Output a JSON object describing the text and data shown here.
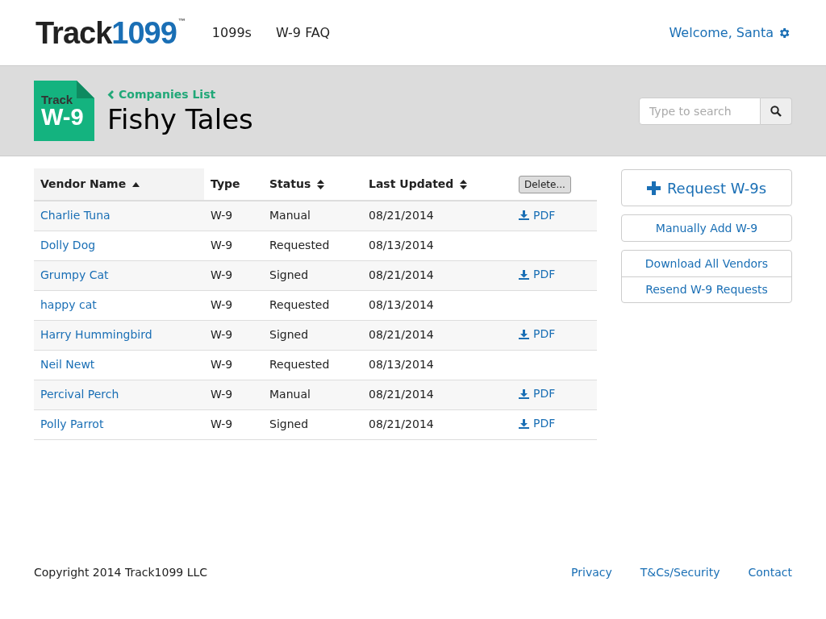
{
  "logo": {
    "word": "Track",
    "number": "1099",
    "mark": "™"
  },
  "nav": [
    {
      "label": "1099s"
    },
    {
      "label": "W-9 FAQ"
    }
  ],
  "user": {
    "welcome": "Welcome, Santa"
  },
  "badge": {
    "top": "Track",
    "main": "W-9"
  },
  "breadcrumb": {
    "label": "Companies List"
  },
  "page_title": "Fishy Tales",
  "search": {
    "placeholder": "Type to search"
  },
  "table": {
    "columns": [
      {
        "label": "Vendor Name",
        "sortable": true,
        "sorted": true
      },
      {
        "label": "Type",
        "sortable": false,
        "sorted": false
      },
      {
        "label": "Status",
        "sortable": true,
        "sorted": false
      },
      {
        "label": "Last Updated",
        "sortable": true,
        "sorted": false
      }
    ],
    "delete_button": "Delete...",
    "rows": [
      {
        "name": "Charlie Tuna",
        "type": "W-9",
        "status": "Manual",
        "updated": "08/21/2014",
        "pdf": "PDF"
      },
      {
        "name": "Dolly Dog",
        "type": "W-9",
        "status": "Requested",
        "updated": "08/13/2014"
      },
      {
        "name": "Grumpy Cat",
        "type": "W-9",
        "status": "Signed",
        "updated": "08/21/2014",
        "pdf": "PDF"
      },
      {
        "name": "happy cat",
        "type": "W-9",
        "status": "Requested",
        "updated": "08/13/2014"
      },
      {
        "name": "Harry Hummingbird",
        "type": "W-9",
        "status": "Signed",
        "updated": "08/21/2014",
        "pdf": "PDF"
      },
      {
        "name": "Neil Newt",
        "type": "W-9",
        "status": "Requested",
        "updated": "08/13/2014"
      },
      {
        "name": "Percival Perch",
        "type": "W-9",
        "status": "Manual",
        "updated": "08/21/2014",
        "pdf": "PDF"
      },
      {
        "name": "Polly Parrot",
        "type": "W-9",
        "status": "Signed",
        "updated": "08/21/2014",
        "pdf": "PDF"
      }
    ]
  },
  "actions": {
    "primary": "Request W-9s",
    "secondary": "Manually Add W-9",
    "group": [
      "Download All Vendors",
      "Resend W-9 Requests"
    ]
  },
  "footer": {
    "copyright": "Copyright 2014 Track1099 LLC",
    "links": [
      "Privacy",
      "T&Cs/Security",
      "Contact"
    ]
  }
}
